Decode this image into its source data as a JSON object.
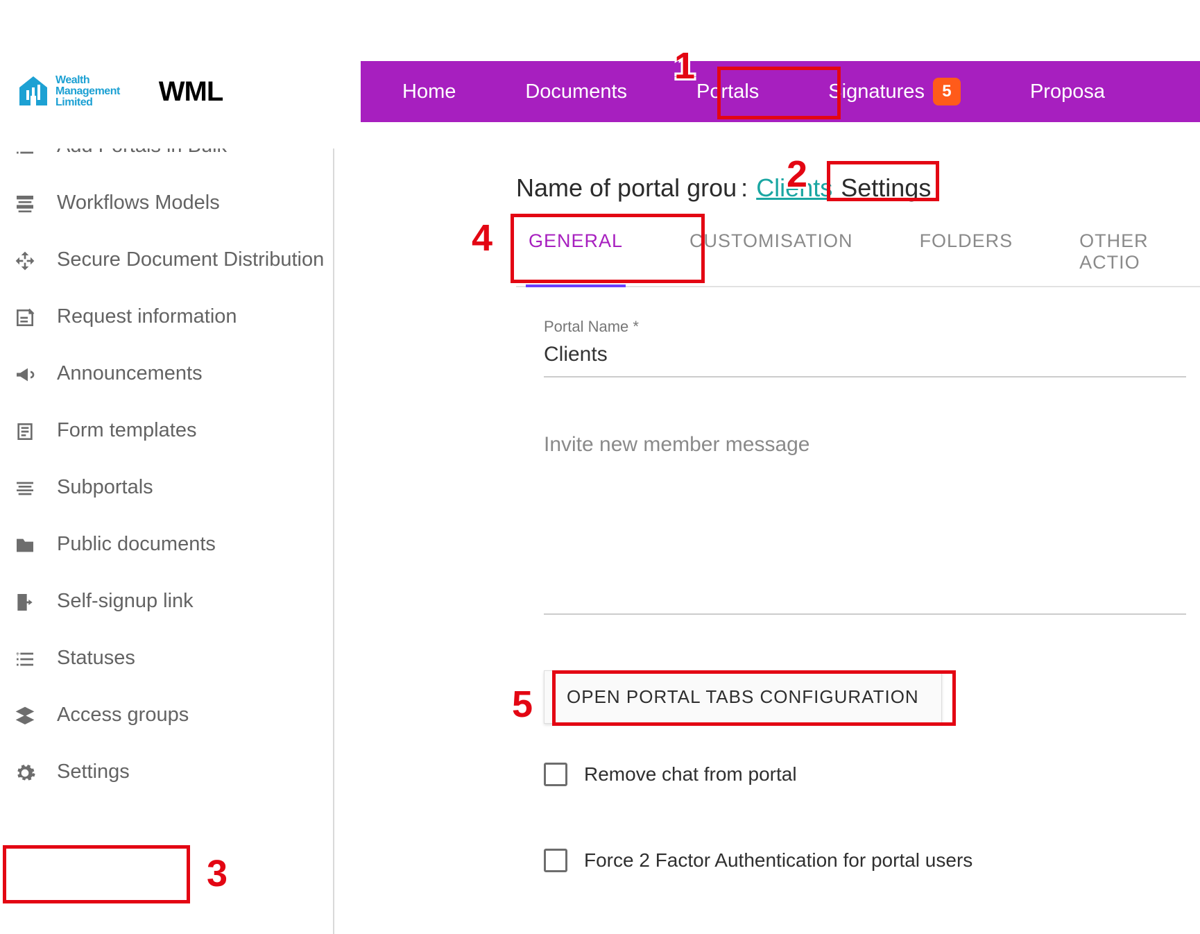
{
  "header": {
    "logo_line1": "Wealth",
    "logo_line2": "Management",
    "logo_line3": "Limited",
    "logo_color": "#1da1d3",
    "app_name": "WML",
    "nav": {
      "home": "Home",
      "documents": "Documents",
      "portals": "Portals",
      "signatures": "Signatures",
      "signatures_badge": "5",
      "proposals": "Proposa"
    }
  },
  "sidebar": {
    "items": [
      {
        "label": "Add Portals in Bulk",
        "icon": "list-icon"
      },
      {
        "label": "Workflows Models",
        "icon": "workflow-icon"
      },
      {
        "label": "Secure Document Distribution",
        "icon": "distribute-icon"
      },
      {
        "label": "Request information",
        "icon": "request-icon"
      },
      {
        "label": "Announcements",
        "icon": "megaphone-icon"
      },
      {
        "label": "Form templates",
        "icon": "form-icon"
      },
      {
        "label": "Subportals",
        "icon": "subportal-icon"
      },
      {
        "label": "Public documents",
        "icon": "folder-icon"
      },
      {
        "label": "Self-signup link",
        "icon": "door-icon"
      },
      {
        "label": "Statuses",
        "icon": "status-icon"
      },
      {
        "label": "Access groups",
        "icon": "layers-icon"
      },
      {
        "label": "Settings",
        "icon": "gear-icon"
      }
    ]
  },
  "page": {
    "title_prefix": "Name of portal grou",
    "title_colon": ": ",
    "title_link": "Clients",
    "title_suffix": "Settings",
    "tabs": {
      "general": "GENERAL",
      "customisation": "CUSTOMISATION",
      "folders": "FOLDERS",
      "other": "OTHER ACTIO"
    },
    "form": {
      "portal_name_label": "Portal Name *",
      "portal_name_value": "Clients",
      "invite_message_label": "Invite new member message",
      "open_config_btn": "OPEN PORTAL TABS CONFIGURATION",
      "remove_chat_label": "Remove chat from portal",
      "force_2fa_label": "Force 2 Factor Authentication for portal users"
    }
  },
  "annotations": {
    "n1": "1",
    "n2": "2",
    "n3": "3",
    "n4": "4",
    "n5": "5"
  }
}
